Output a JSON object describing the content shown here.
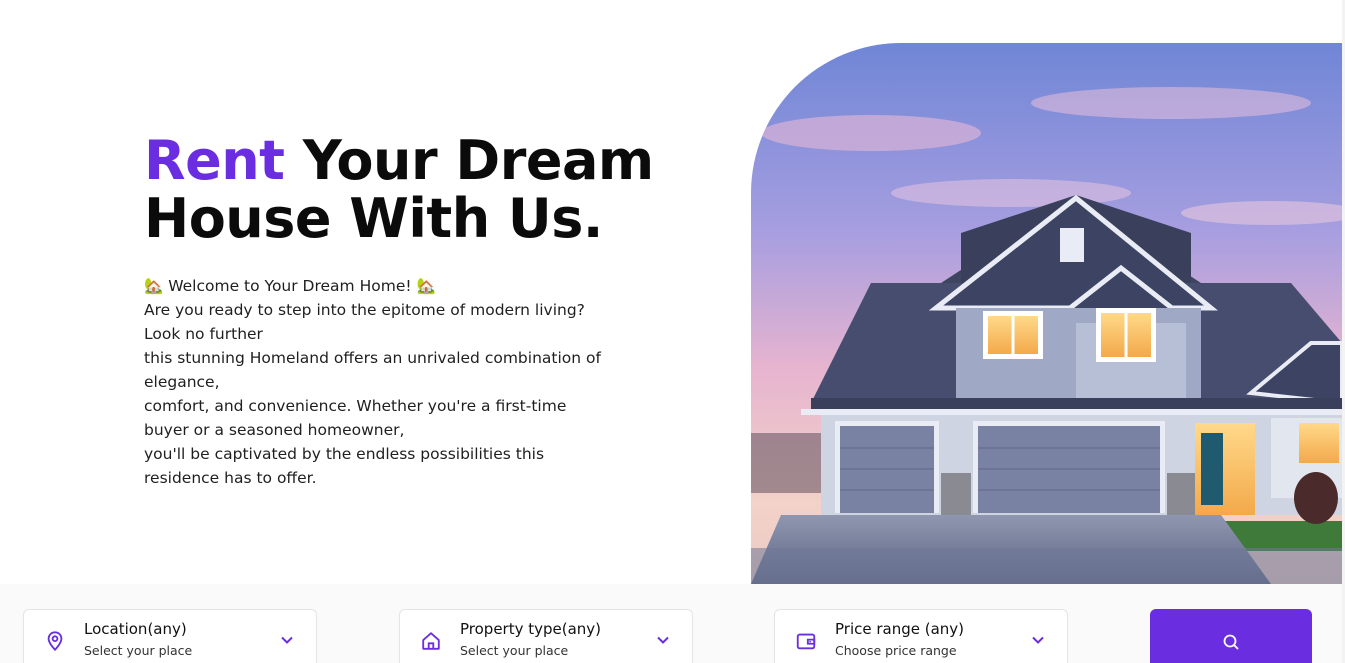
{
  "hero": {
    "title_accent": "Rent",
    "title_line1_rest": " Your Dream",
    "title_line2": "House With Us.",
    "body_lines": [
      "🏡 Welcome to Your Dream Home! 🏡",
      "Are you ready to step into the epitome of modern living?",
      "Look no further",
      "this stunning Homeland offers an unrivaled combination of",
      "elegance,",
      "comfort, and convenience. Whether you're a first-time",
      "buyer or a seasoned homeowner,",
      "you'll be captivated by the endless possibilities this",
      "residence has to offer."
    ]
  },
  "search": {
    "filters": [
      {
        "label": "Location(any)",
        "sub": "Select your place",
        "icon": "location-pin-icon"
      },
      {
        "label": "Property type(any)",
        "sub": "Select your place",
        "icon": "house-icon"
      },
      {
        "label": "Price range (any)",
        "sub": "Choose price range",
        "icon": "wallet-icon"
      }
    ],
    "button_icon": "search-icon"
  },
  "colors": {
    "accent": "#6a2ee0",
    "text": "#0b0b0b"
  }
}
